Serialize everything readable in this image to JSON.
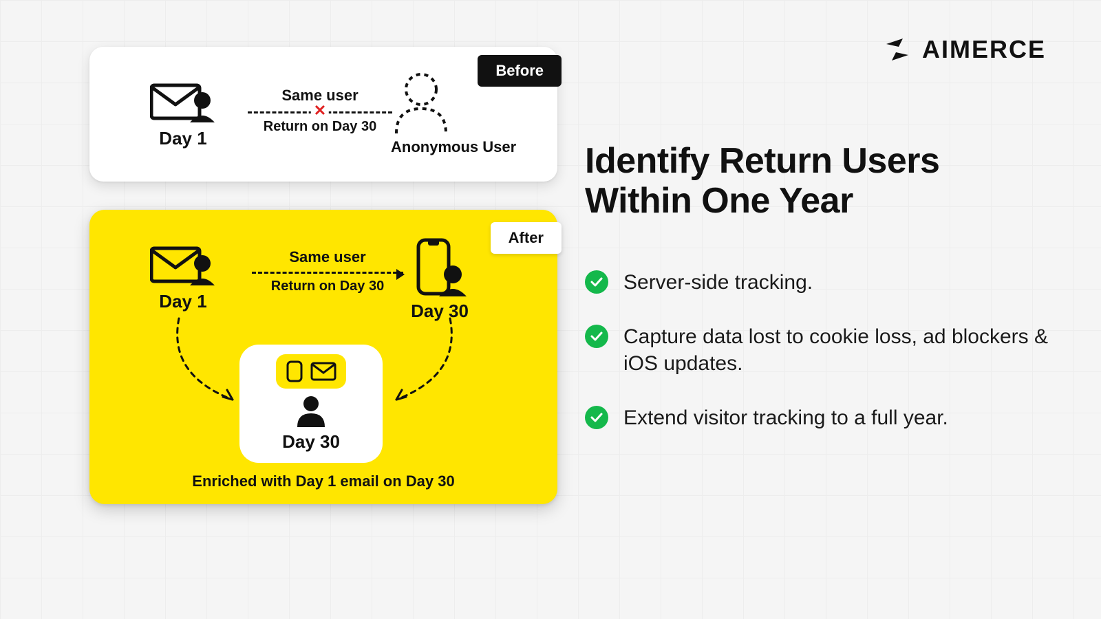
{
  "brand": {
    "name": "AIMERCE"
  },
  "headline": "Identify Return Users Within One Year",
  "bullets": [
    "Server-side tracking.",
    "Capture data lost to cookie loss, ad blockers & iOS updates.",
    "Extend visitor tracking to a full year."
  ],
  "before": {
    "tag": "Before",
    "day1_label": "Day 1",
    "same_user": "Same user",
    "return_line": "Return on Day 30",
    "anon_label": "Anonymous User"
  },
  "after": {
    "tag": "After",
    "day1_label": "Day 1",
    "same_user": "Same user",
    "return_line": "Return on Day 30",
    "day30_label": "Day 30",
    "enrich_day_label": "Day 30",
    "caption": "Enriched with Day 1 email on Day 30"
  },
  "colors": {
    "accent_yellow": "#ffe600",
    "success_green": "#14b84b",
    "error_red": "#e02020"
  }
}
